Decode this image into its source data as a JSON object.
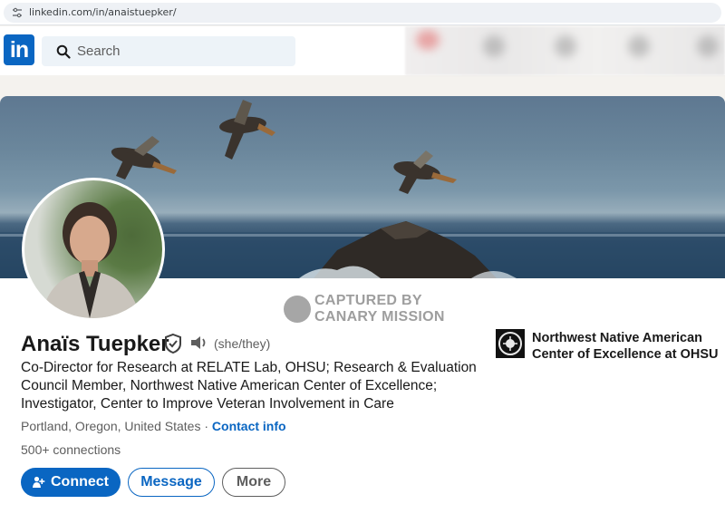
{
  "browser": {
    "url": "linkedin.com/in/anaistuepker/"
  },
  "nav": {
    "logo_text": "in",
    "search_placeholder": "Search"
  },
  "watermark": {
    "line1": "CAPTURED BY",
    "line2": "CANARY MISSION"
  },
  "profile": {
    "name": "Anaïs Tuepker",
    "pronouns": "(she/they)",
    "headline": "Co-Director for Research at RELATE Lab, OHSU; Research & Evaluation Council Member, Northwest Native American Center of Excellence; Investigator, Center to Improve Veteran Involvement in Care",
    "location": "Portland, Oregon, United States",
    "separator": " · ",
    "contact_info": "Contact info",
    "connections": "500+ connections"
  },
  "actions": {
    "connect": "Connect",
    "message": "Message",
    "more": "More"
  },
  "organization": {
    "name": "Northwest Native American Center of Excellence at OHSU"
  },
  "colors": {
    "brand": "#0a66c2",
    "page_bg": "#f4f2ee"
  }
}
